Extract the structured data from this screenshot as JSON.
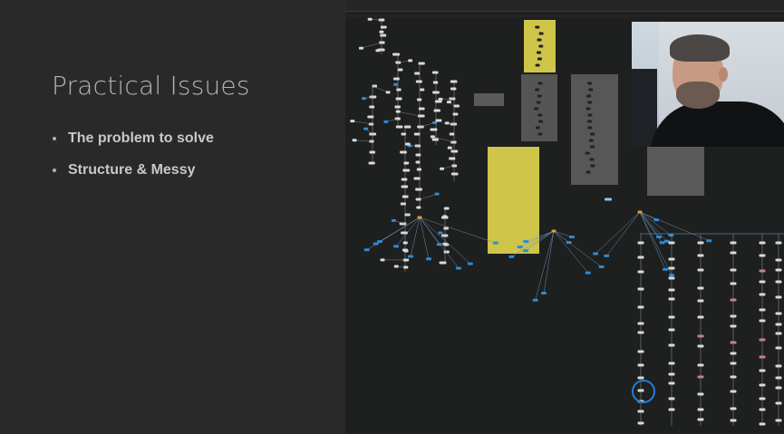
{
  "slide": {
    "title": "Practical Issues",
    "bullets": [
      "The problem to solve",
      "Structure & Messy"
    ]
  },
  "graph": {
    "node_color": "#d9d9d9",
    "link_color": "#9a9a9a",
    "accent_blue": "#2d8bd4",
    "backdrop_yellow": "#cfc548",
    "backdrop_gray": "#5a5a5a"
  },
  "webcam": {
    "icon": "presenter-webcam"
  }
}
